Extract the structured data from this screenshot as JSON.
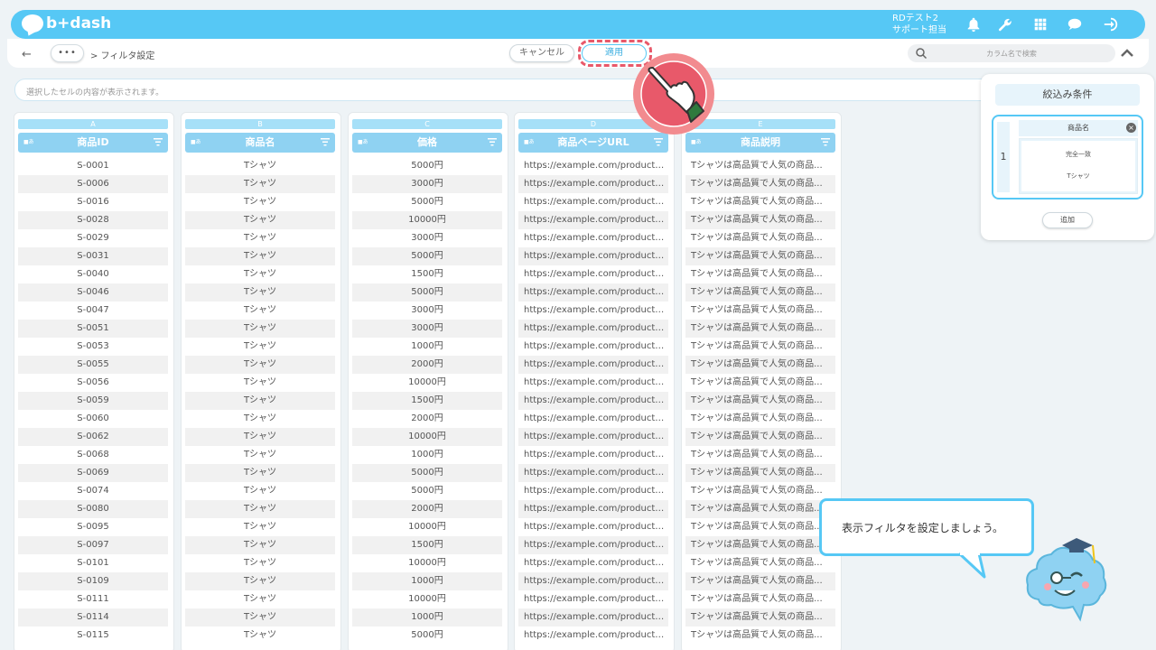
{
  "header": {
    "logo_text": "b+dash",
    "user_name": "RDテスト2",
    "user_role": "サポート担当",
    "icons": [
      "bell-icon",
      "wrench-icon",
      "grid-icon",
      "chat-icon",
      "logout-icon"
    ]
  },
  "toolbar": {
    "back_icon": "back-arrow-icon",
    "more_label": "•••",
    "breadcrumb": "> フィルタ設定",
    "cancel_label": "キャンセル",
    "apply_label": "適用",
    "search_placeholder": "カラム名で検索"
  },
  "cell_bar_placeholder": "選択したセルの内容が表示されます。",
  "columns": [
    {
      "letter": "A",
      "title": "商品ID",
      "type_label": "■あ"
    },
    {
      "letter": "B",
      "title": "商品名",
      "type_label": "■あ"
    },
    {
      "letter": "C",
      "title": "価格",
      "type_label": "■あ"
    },
    {
      "letter": "D",
      "title": "商品ページURL",
      "type_label": "■あ"
    },
    {
      "letter": "E",
      "title": "商品説明",
      "type_label": "■あ"
    }
  ],
  "rows": [
    [
      "S-0001",
      "Tシャツ",
      "5000円",
      "https://example.com/products/...",
      "Tシャツは高品質で人気の商品..."
    ],
    [
      "S-0006",
      "Tシャツ",
      "3000円",
      "https://example.com/products/...",
      "Tシャツは高品質で人気の商品..."
    ],
    [
      "S-0016",
      "Tシャツ",
      "5000円",
      "https://example.com/products/...",
      "Tシャツは高品質で人気の商品..."
    ],
    [
      "S-0028",
      "Tシャツ",
      "10000円",
      "https://example.com/products/...",
      "Tシャツは高品質で人気の商品..."
    ],
    [
      "S-0029",
      "Tシャツ",
      "3000円",
      "https://example.com/products/...",
      "Tシャツは高品質で人気の商品..."
    ],
    [
      "S-0031",
      "Tシャツ",
      "5000円",
      "https://example.com/products/...",
      "Tシャツは高品質で人気の商品..."
    ],
    [
      "S-0040",
      "Tシャツ",
      "1500円",
      "https://example.com/products/...",
      "Tシャツは高品質で人気の商品..."
    ],
    [
      "S-0046",
      "Tシャツ",
      "5000円",
      "https://example.com/products/...",
      "Tシャツは高品質で人気の商品..."
    ],
    [
      "S-0047",
      "Tシャツ",
      "3000円",
      "https://example.com/products/...",
      "Tシャツは高品質で人気の商品..."
    ],
    [
      "S-0051",
      "Tシャツ",
      "3000円",
      "https://example.com/products/...",
      "Tシャツは高品質で人気の商品..."
    ],
    [
      "S-0053",
      "Tシャツ",
      "1000円",
      "https://example.com/products/...",
      "Tシャツは高品質で人気の商品..."
    ],
    [
      "S-0055",
      "Tシャツ",
      "2000円",
      "https://example.com/products/...",
      "Tシャツは高品質で人気の商品..."
    ],
    [
      "S-0056",
      "Tシャツ",
      "10000円",
      "https://example.com/products/...",
      "Tシャツは高品質で人気の商品..."
    ],
    [
      "S-0059",
      "Tシャツ",
      "1500円",
      "https://example.com/products/...",
      "Tシャツは高品質で人気の商品..."
    ],
    [
      "S-0060",
      "Tシャツ",
      "2000円",
      "https://example.com/products/...",
      "Tシャツは高品質で人気の商品..."
    ],
    [
      "S-0062",
      "Tシャツ",
      "10000円",
      "https://example.com/products/...",
      "Tシャツは高品質で人気の商品..."
    ],
    [
      "S-0068",
      "Tシャツ",
      "1000円",
      "https://example.com/products/...",
      "Tシャツは高品質で人気の商品..."
    ],
    [
      "S-0069",
      "Tシャツ",
      "5000円",
      "https://example.com/products/...",
      "Tシャツは高品質で人気の商品..."
    ],
    [
      "S-0074",
      "Tシャツ",
      "5000円",
      "https://example.com/products/...",
      "Tシャツは高品質で人気の商品..."
    ],
    [
      "S-0080",
      "Tシャツ",
      "2000円",
      "https://example.com/products/...",
      "Tシャツは高品質で人気の商品..."
    ],
    [
      "S-0095",
      "Tシャツ",
      "10000円",
      "https://example.com/products/...",
      "Tシャツは高品質で人気の商品..."
    ],
    [
      "S-0097",
      "Tシャツ",
      "1500円",
      "https://example.com/products/...",
      "Tシャツは高品質で人気の商品..."
    ],
    [
      "S-0101",
      "Tシャツ",
      "10000円",
      "https://example.com/products/...",
      "Tシャツは高品質で人気の商品..."
    ],
    [
      "S-0109",
      "Tシャツ",
      "1000円",
      "https://example.com/products/...",
      "Tシャツは高品質で人気の商品..."
    ],
    [
      "S-0111",
      "Tシャツ",
      "10000円",
      "https://example.com/products/...",
      "Tシャツは高品質で人気の商品..."
    ],
    [
      "S-0114",
      "Tシャツ",
      "1000円",
      "https://example.com/products/...",
      "Tシャツは高品質で人気の商品..."
    ],
    [
      "S-0115",
      "Tシャツ",
      "5000円",
      "https://example.com/products/...",
      "Tシャツは高品質で人気の商品..."
    ]
  ],
  "filter_panel": {
    "title": "絞込み条件",
    "conditions": [
      {
        "number": "1",
        "column": "商品名",
        "operator": "完全一致",
        "value": "Tシャツ"
      }
    ],
    "add_label": "追加"
  },
  "tutorial": {
    "message": "表示フィルタを設定しましょう。"
  },
  "colors": {
    "primary": "#56c8f5",
    "highlight": "#e8596a",
    "header_cell": "#8fd2f2"
  }
}
